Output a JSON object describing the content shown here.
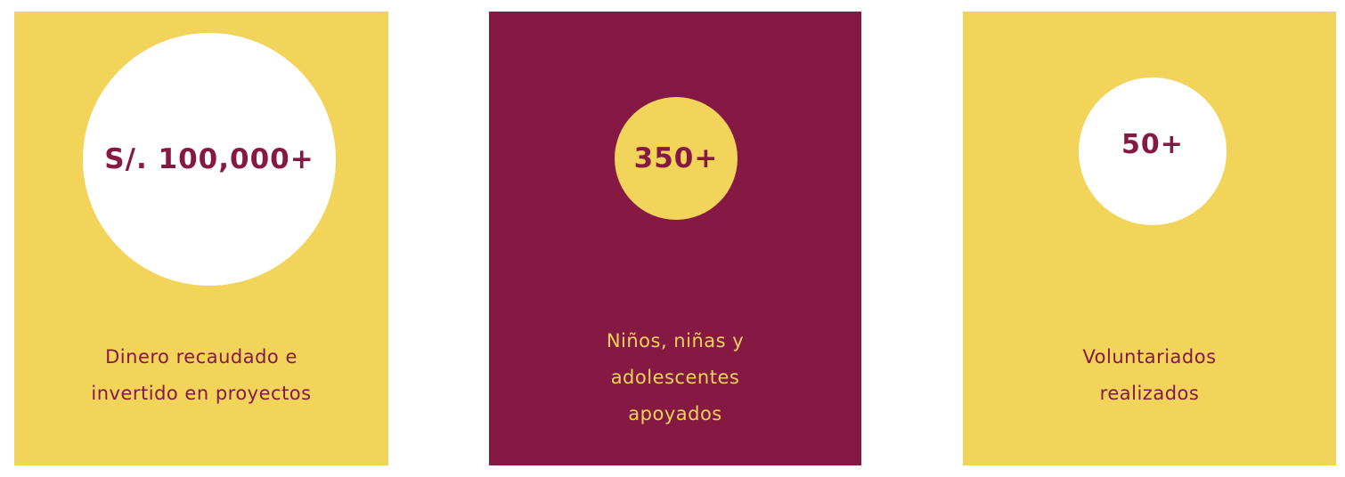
{
  "stats": [
    {
      "value": "S/. 100,000+",
      "label_lines": [
        "Dinero recaudado e",
        "invertido en proyectos"
      ]
    },
    {
      "value": "350+",
      "label_lines": [
        "Niños, niñas y",
        "adolescentes",
        "apoyados"
      ]
    },
    {
      "value": "50+",
      "label_lines": [
        "Voluntariados",
        "realizados"
      ]
    }
  ],
  "colors": {
    "yellow": "#F2D45A",
    "maroon": "#851944",
    "white": "#FFFFFF"
  }
}
